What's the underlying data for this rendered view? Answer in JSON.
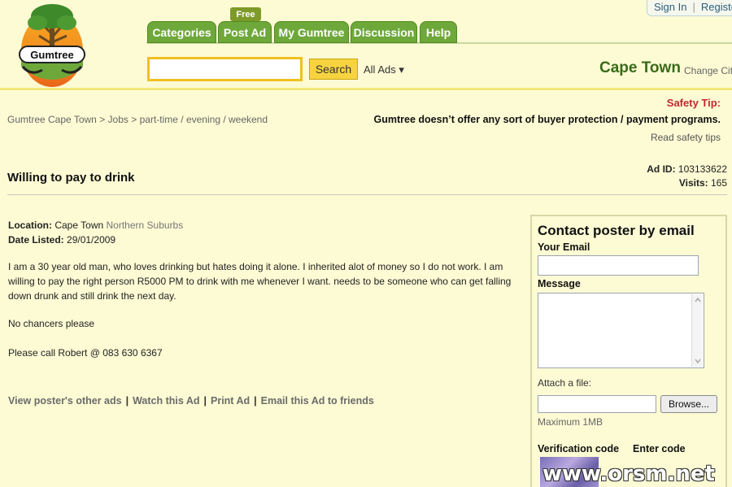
{
  "header": {
    "logo_text": "Gumtree",
    "tabs": [
      {
        "label": "Categories"
      },
      {
        "label": "Post Ad"
      },
      {
        "label": "My Gumtree"
      },
      {
        "label": "Discussion"
      },
      {
        "label": "Help"
      }
    ],
    "free_badge": "Free",
    "search": {
      "value": "",
      "button_label": "Search",
      "scope": "All Ads ▾"
    },
    "city": "Cape Town",
    "change_city": "Change City",
    "sign_in": "Sign In",
    "register": "Register"
  },
  "breadcrumb": {
    "items": [
      "Gumtree Cape Town",
      "Jobs",
      "part-time / evening / weekend"
    ],
    "separator": ">"
  },
  "safety": {
    "title": "Safety Tip:",
    "text": "Gumtree doesn’t offer any sort of buyer protection / payment programs.",
    "link": "Read safety tips"
  },
  "ad": {
    "title": "Willing to pay to drink",
    "id_label": "Ad ID:",
    "id": "103133622",
    "visits_label": "Visits:",
    "visits": "165",
    "location_label": "Location:",
    "location": "Cape Town",
    "location_sub": "Northern Suburbs",
    "date_label": "Date Listed:",
    "date": "29/01/2009",
    "description": "I am a 30 year old man, who loves drinking but hates doing it alone. I inherited alot of money so I do not work. I am willing to pay the right person R5000 PM to drink with me whenever I want. needs to be someone who can get falling down drunk and still drink the next day.",
    "paragraph2": "No chancers please",
    "paragraph3": "Please call Robert @ 083 630 6367",
    "actions": [
      "View poster's other ads",
      "Watch this Ad",
      "Print Ad",
      "Email this Ad to friends"
    ]
  },
  "contact": {
    "title": "Contact poster by email",
    "email_label": "Your Email",
    "email_value": "",
    "message_label": "Message",
    "message_value": "",
    "attach_label": "Attach a file:",
    "browse_label": "Browse...",
    "max_label": "Maximum 1MB",
    "verification_label": "Verification code",
    "enter_code_label": "Enter code"
  },
  "watermark": "www.orsm.net",
  "colors": {
    "background": "#fdfbd4",
    "tab_green": "#6ea83a",
    "city_green": "#3a6b1a",
    "safety_red": "#c0282d",
    "search_yellow": "#f7d43f"
  }
}
